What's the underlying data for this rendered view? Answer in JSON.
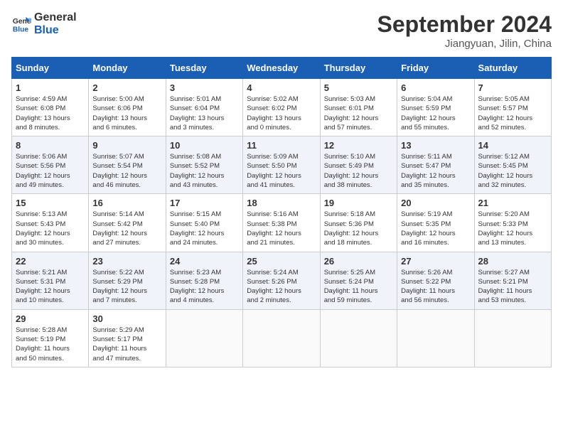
{
  "header": {
    "logo_line1": "General",
    "logo_line2": "Blue",
    "month": "September 2024",
    "location": "Jiangyuan, Jilin, China"
  },
  "days_of_week": [
    "Sunday",
    "Monday",
    "Tuesday",
    "Wednesday",
    "Thursday",
    "Friday",
    "Saturday"
  ],
  "weeks": [
    [
      {
        "day": 1,
        "lines": [
          "Sunrise: 4:59 AM",
          "Sunset: 6:08 PM",
          "Daylight: 13 hours",
          "and 8 minutes."
        ]
      },
      {
        "day": 2,
        "lines": [
          "Sunrise: 5:00 AM",
          "Sunset: 6:06 PM",
          "Daylight: 13 hours",
          "and 6 minutes."
        ]
      },
      {
        "day": 3,
        "lines": [
          "Sunrise: 5:01 AM",
          "Sunset: 6:04 PM",
          "Daylight: 13 hours",
          "and 3 minutes."
        ]
      },
      {
        "day": 4,
        "lines": [
          "Sunrise: 5:02 AM",
          "Sunset: 6:02 PM",
          "Daylight: 13 hours",
          "and 0 minutes."
        ]
      },
      {
        "day": 5,
        "lines": [
          "Sunrise: 5:03 AM",
          "Sunset: 6:01 PM",
          "Daylight: 12 hours",
          "and 57 minutes."
        ]
      },
      {
        "day": 6,
        "lines": [
          "Sunrise: 5:04 AM",
          "Sunset: 5:59 PM",
          "Daylight: 12 hours",
          "and 55 minutes."
        ]
      },
      {
        "day": 7,
        "lines": [
          "Sunrise: 5:05 AM",
          "Sunset: 5:57 PM",
          "Daylight: 12 hours",
          "and 52 minutes."
        ]
      }
    ],
    [
      {
        "day": 8,
        "lines": [
          "Sunrise: 5:06 AM",
          "Sunset: 5:56 PM",
          "Daylight: 12 hours",
          "and 49 minutes."
        ]
      },
      {
        "day": 9,
        "lines": [
          "Sunrise: 5:07 AM",
          "Sunset: 5:54 PM",
          "Daylight: 12 hours",
          "and 46 minutes."
        ]
      },
      {
        "day": 10,
        "lines": [
          "Sunrise: 5:08 AM",
          "Sunset: 5:52 PM",
          "Daylight: 12 hours",
          "and 43 minutes."
        ]
      },
      {
        "day": 11,
        "lines": [
          "Sunrise: 5:09 AM",
          "Sunset: 5:50 PM",
          "Daylight: 12 hours",
          "and 41 minutes."
        ]
      },
      {
        "day": 12,
        "lines": [
          "Sunrise: 5:10 AM",
          "Sunset: 5:49 PM",
          "Daylight: 12 hours",
          "and 38 minutes."
        ]
      },
      {
        "day": 13,
        "lines": [
          "Sunrise: 5:11 AM",
          "Sunset: 5:47 PM",
          "Daylight: 12 hours",
          "and 35 minutes."
        ]
      },
      {
        "day": 14,
        "lines": [
          "Sunrise: 5:12 AM",
          "Sunset: 5:45 PM",
          "Daylight: 12 hours",
          "and 32 minutes."
        ]
      }
    ],
    [
      {
        "day": 15,
        "lines": [
          "Sunrise: 5:13 AM",
          "Sunset: 5:43 PM",
          "Daylight: 12 hours",
          "and 30 minutes."
        ]
      },
      {
        "day": 16,
        "lines": [
          "Sunrise: 5:14 AM",
          "Sunset: 5:42 PM",
          "Daylight: 12 hours",
          "and 27 minutes."
        ]
      },
      {
        "day": 17,
        "lines": [
          "Sunrise: 5:15 AM",
          "Sunset: 5:40 PM",
          "Daylight: 12 hours",
          "and 24 minutes."
        ]
      },
      {
        "day": 18,
        "lines": [
          "Sunrise: 5:16 AM",
          "Sunset: 5:38 PM",
          "Daylight: 12 hours",
          "and 21 minutes."
        ]
      },
      {
        "day": 19,
        "lines": [
          "Sunrise: 5:18 AM",
          "Sunset: 5:36 PM",
          "Daylight: 12 hours",
          "and 18 minutes."
        ]
      },
      {
        "day": 20,
        "lines": [
          "Sunrise: 5:19 AM",
          "Sunset: 5:35 PM",
          "Daylight: 12 hours",
          "and 16 minutes."
        ]
      },
      {
        "day": 21,
        "lines": [
          "Sunrise: 5:20 AM",
          "Sunset: 5:33 PM",
          "Daylight: 12 hours",
          "and 13 minutes."
        ]
      }
    ],
    [
      {
        "day": 22,
        "lines": [
          "Sunrise: 5:21 AM",
          "Sunset: 5:31 PM",
          "Daylight: 12 hours",
          "and 10 minutes."
        ]
      },
      {
        "day": 23,
        "lines": [
          "Sunrise: 5:22 AM",
          "Sunset: 5:29 PM",
          "Daylight: 12 hours",
          "and 7 minutes."
        ]
      },
      {
        "day": 24,
        "lines": [
          "Sunrise: 5:23 AM",
          "Sunset: 5:28 PM",
          "Daylight: 12 hours",
          "and 4 minutes."
        ]
      },
      {
        "day": 25,
        "lines": [
          "Sunrise: 5:24 AM",
          "Sunset: 5:26 PM",
          "Daylight: 12 hours",
          "and 2 minutes."
        ]
      },
      {
        "day": 26,
        "lines": [
          "Sunrise: 5:25 AM",
          "Sunset: 5:24 PM",
          "Daylight: 11 hours",
          "and 59 minutes."
        ]
      },
      {
        "day": 27,
        "lines": [
          "Sunrise: 5:26 AM",
          "Sunset: 5:22 PM",
          "Daylight: 11 hours",
          "and 56 minutes."
        ]
      },
      {
        "day": 28,
        "lines": [
          "Sunrise: 5:27 AM",
          "Sunset: 5:21 PM",
          "Daylight: 11 hours",
          "and 53 minutes."
        ]
      }
    ],
    [
      {
        "day": 29,
        "lines": [
          "Sunrise: 5:28 AM",
          "Sunset: 5:19 PM",
          "Daylight: 11 hours",
          "and 50 minutes."
        ]
      },
      {
        "day": 30,
        "lines": [
          "Sunrise: 5:29 AM",
          "Sunset: 5:17 PM",
          "Daylight: 11 hours",
          "and 47 minutes."
        ]
      },
      null,
      null,
      null,
      null,
      null
    ]
  ]
}
